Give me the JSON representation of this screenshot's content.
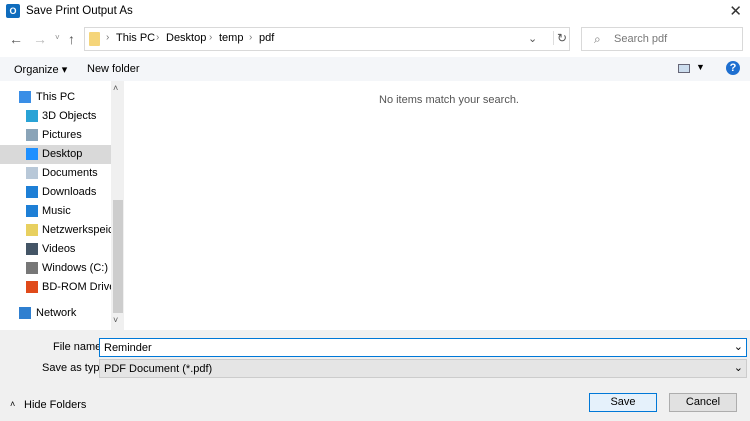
{
  "window": {
    "title": "Save Print Output As",
    "app_icon": "outlook-icon"
  },
  "address": {
    "breadcrumbs": [
      "This PC",
      "Desktop",
      "temp",
      "pdf"
    ]
  },
  "search": {
    "placeholder": "Search pdf"
  },
  "toolbar": {
    "organize": "Organize ▾",
    "new_folder": "New folder"
  },
  "sidebar": {
    "items": [
      {
        "label": "This PC",
        "icon": "computer-icon",
        "color": "#3a8ee6"
      },
      {
        "label": "3D Objects",
        "icon": "cube-icon",
        "color": "#29a3d6"
      },
      {
        "label": "Pictures",
        "icon": "pictures-icon",
        "color": "#8aa4b8"
      },
      {
        "label": "Desktop",
        "icon": "desktop-icon",
        "color": "#1e90ff",
        "selected": true
      },
      {
        "label": "Documents",
        "icon": "document-icon",
        "color": "#b8c8d8"
      },
      {
        "label": "Downloads",
        "icon": "download-icon",
        "color": "#1e7fd6"
      },
      {
        "label": "Music",
        "icon": "music-icon",
        "color": "#1e7fd6"
      },
      {
        "label": "Netzwerkspeicher",
        "icon": "network-drive-icon",
        "color": "#e8d060"
      },
      {
        "label": "Videos",
        "icon": "videos-icon",
        "color": "#445566"
      },
      {
        "label": "Windows (C:)",
        "icon": "drive-icon",
        "color": "#777"
      },
      {
        "label": "BD-ROM Drive (I",
        "icon": "office-icon",
        "color": "#e04a1a"
      },
      {
        "label": "Network",
        "icon": "network-icon",
        "color": "#2f7fd0"
      }
    ]
  },
  "main": {
    "empty_message": "No items match your search."
  },
  "form": {
    "file_name_label": "File name:",
    "file_name_value": "Reminder",
    "type_label": "Save as type:",
    "type_value": "PDF Document (*.pdf)"
  },
  "footer": {
    "hide_folders": "Hide Folders",
    "save": "Save",
    "cancel": "Cancel"
  }
}
